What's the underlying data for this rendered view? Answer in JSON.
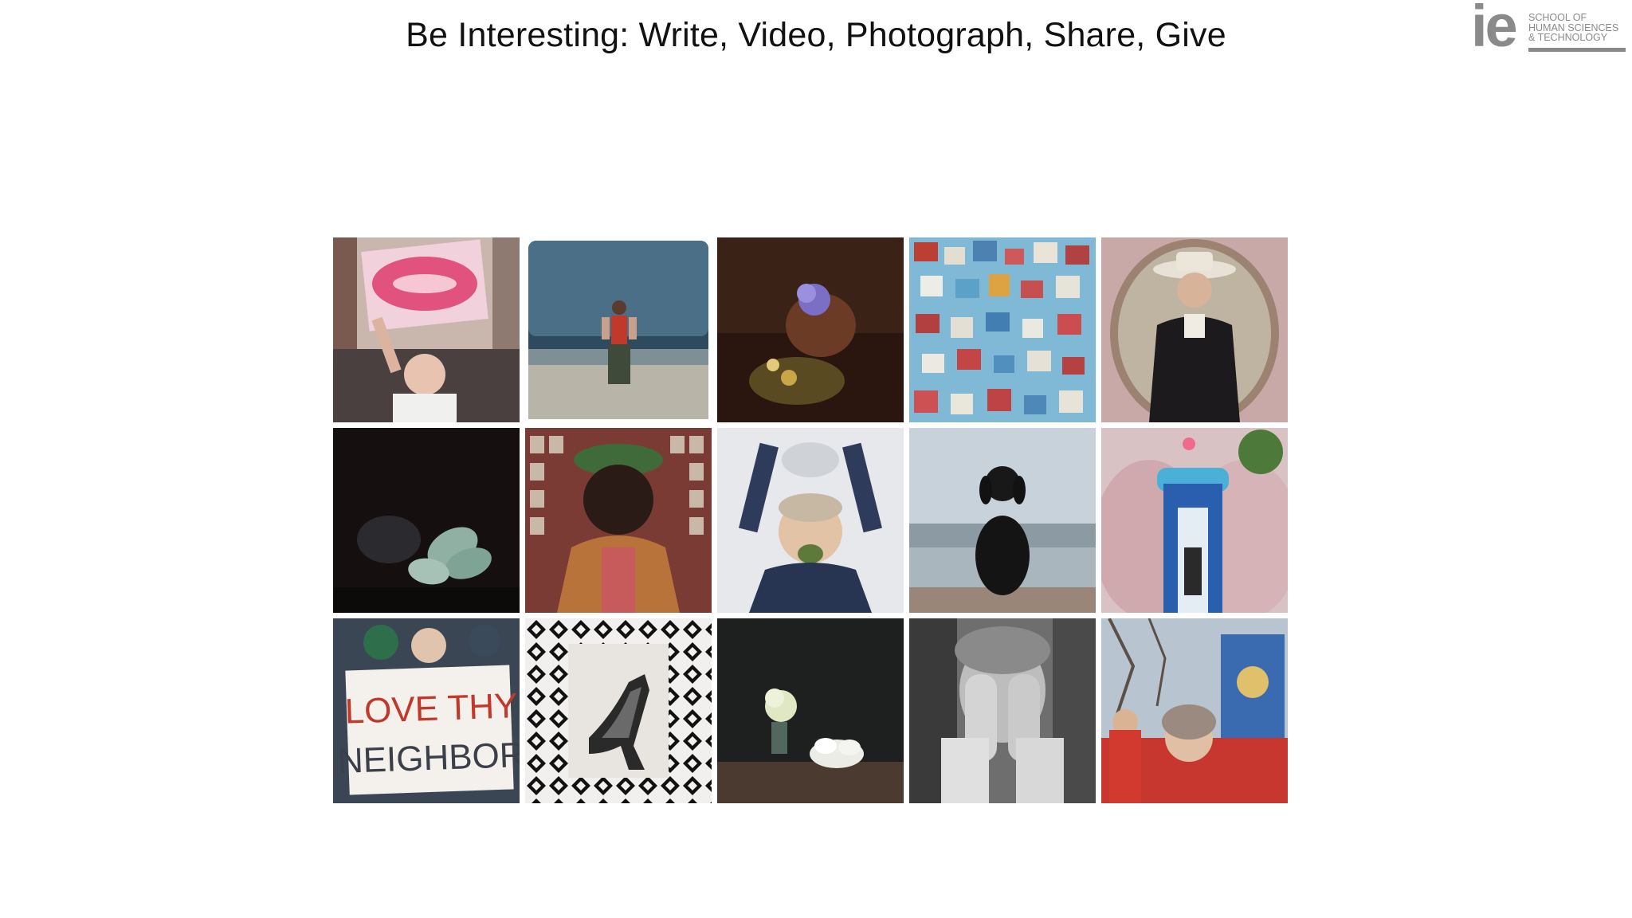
{
  "slide": {
    "title": "Be Interesting: Write, Video, Photograph, Share, Give"
  },
  "logo": {
    "mark": "ie",
    "lines": [
      "SCHOOL OF",
      "HUMAN SCIENCES",
      "& TECHNOLOGY"
    ],
    "color": "#8a8a8a"
  },
  "collage": {
    "rows": 3,
    "columns": 5,
    "tiles": [
      {
        "subject": "protest-sign-lips"
      },
      {
        "subject": "person-on-beach"
      },
      {
        "subject": "flowers-dark-still-life"
      },
      {
        "subject": "colorful-quilt"
      },
      {
        "subject": "cowboy-portrait"
      },
      {
        "subject": "dark-hands-still-life"
      },
      {
        "subject": "man-with-hat-portrait"
      },
      {
        "subject": "woman-arms-raised"
      },
      {
        "subject": "dog-at-lake"
      },
      {
        "subject": "blue-arch-sculpture"
      },
      {
        "subject": "love-thy-neighbor-sign",
        "sign_lines": [
          "LOVE THY",
          "NEIGHBOR"
        ]
      },
      {
        "subject": "high-heel-shoe-pattern"
      },
      {
        "subject": "white-flowers-still-life"
      },
      {
        "subject": "face-covered-hands"
      },
      {
        "subject": "protest-crowd-red"
      }
    ]
  }
}
